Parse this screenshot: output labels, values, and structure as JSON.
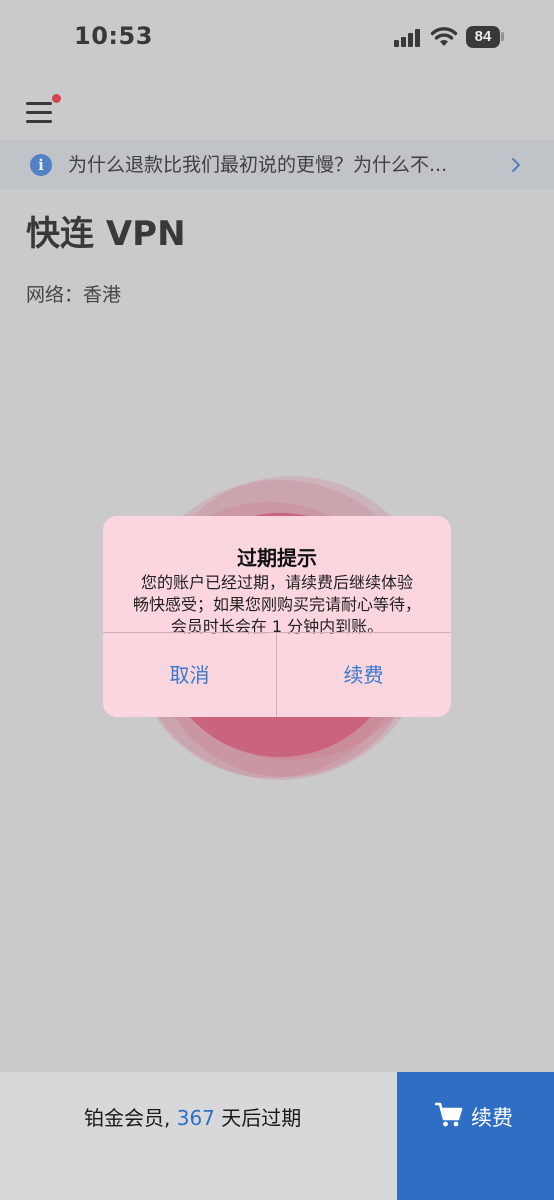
{
  "status_bar": {
    "time": "10:53",
    "battery": "84"
  },
  "header": {
    "menu_icon": "hamburger-menu-icon",
    "has_notification_dot": true
  },
  "notice": {
    "icon": "info-icon",
    "text": "为什么退款比我们最初说的更慢？为什么不...",
    "arrow_icon": "chevron-right-icon"
  },
  "app": {
    "title": "快连 VPN",
    "network_label": "网络：香港"
  },
  "dialog": {
    "title": "过期提示",
    "message_lines": [
      "您的账户已经过期，请续费后继续体验",
      "畅快感受；如果您刚购买完请耐心等待，",
      "会员时长会在 1 分钟内到账。"
    ],
    "cancel_label": "取消",
    "renew_label": "续费"
  },
  "footer": {
    "member_prefix": "铂金会员, ",
    "days": "367",
    "member_suffix": " 天后过期",
    "renew_label": "续费",
    "renew_icon": "cart-icon"
  },
  "colors": {
    "accent": "#2e6fc5",
    "connect_circle": "#d4506e",
    "dialog_bg": "#fbd6df"
  }
}
